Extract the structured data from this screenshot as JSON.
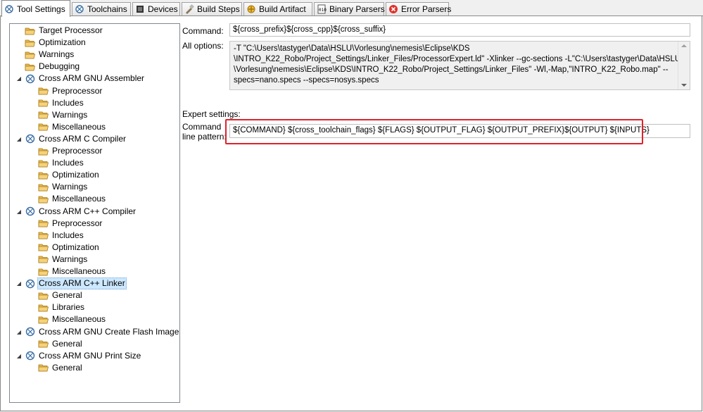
{
  "tabs": [
    {
      "label": "Tool Settings",
      "icon": "tool-settings-icon"
    },
    {
      "label": "Toolchains",
      "icon": "toolchains-icon"
    },
    {
      "label": "Devices",
      "icon": "devices-icon"
    },
    {
      "label": "Build Steps",
      "icon": "build-steps-icon"
    },
    {
      "label": "Build Artifact",
      "icon": "build-artifact-icon"
    },
    {
      "label": "Binary Parsers",
      "icon": "binary-parsers-icon"
    },
    {
      "label": "Error Parsers",
      "icon": "error-parsers-icon"
    }
  ],
  "tree": {
    "items": [
      {
        "label": "Target Processor",
        "level": 1,
        "type": "folder"
      },
      {
        "label": "Optimization",
        "level": 1,
        "type": "folder"
      },
      {
        "label": "Warnings",
        "level": 1,
        "type": "folder"
      },
      {
        "label": "Debugging",
        "level": 1,
        "type": "folder"
      },
      {
        "label": "Cross ARM GNU Assembler",
        "level": 1,
        "type": "tool",
        "expanded": true
      },
      {
        "label": "Preprocessor",
        "level": 2,
        "type": "folder"
      },
      {
        "label": "Includes",
        "level": 2,
        "type": "folder"
      },
      {
        "label": "Warnings",
        "level": 2,
        "type": "folder"
      },
      {
        "label": "Miscellaneous",
        "level": 2,
        "type": "folder"
      },
      {
        "label": "Cross ARM C Compiler",
        "level": 1,
        "type": "tool",
        "expanded": true
      },
      {
        "label": "Preprocessor",
        "level": 2,
        "type": "folder"
      },
      {
        "label": "Includes",
        "level": 2,
        "type": "folder"
      },
      {
        "label": "Optimization",
        "level": 2,
        "type": "folder"
      },
      {
        "label": "Warnings",
        "level": 2,
        "type": "folder"
      },
      {
        "label": "Miscellaneous",
        "level": 2,
        "type": "folder"
      },
      {
        "label": "Cross ARM C++ Compiler",
        "level": 1,
        "type": "tool",
        "expanded": true
      },
      {
        "label": "Preprocessor",
        "level": 2,
        "type": "folder"
      },
      {
        "label": "Includes",
        "level": 2,
        "type": "folder"
      },
      {
        "label": "Optimization",
        "level": 2,
        "type": "folder"
      },
      {
        "label": "Warnings",
        "level": 2,
        "type": "folder"
      },
      {
        "label": "Miscellaneous",
        "level": 2,
        "type": "folder"
      },
      {
        "label": "Cross ARM C++ Linker",
        "level": 1,
        "type": "tool",
        "expanded": true,
        "selected": true
      },
      {
        "label": "General",
        "level": 2,
        "type": "folder"
      },
      {
        "label": "Libraries",
        "level": 2,
        "type": "folder"
      },
      {
        "label": "Miscellaneous",
        "level": 2,
        "type": "folder"
      },
      {
        "label": "Cross ARM GNU Create Flash Image",
        "level": 1,
        "type": "tool",
        "expanded": true
      },
      {
        "label": "General",
        "level": 2,
        "type": "folder"
      },
      {
        "label": "Cross ARM GNU Print Size",
        "level": 1,
        "type": "tool",
        "expanded": true
      },
      {
        "label": "General",
        "level": 2,
        "type": "folder"
      }
    ]
  },
  "settings": {
    "command_label": "Command:",
    "command_value": "${cross_prefix}${cross_cpp}${cross_suffix}",
    "all_options_label": "All options:",
    "all_options_lines": [
      "-T \"C:\\Users\\tastyger\\Data\\HSLU\\Vorlesung\\nemesis\\Eclipse\\KDS",
      "\\INTRO_K22_Robo/Project_Settings/Linker_Files/ProcessorExpert.ld\" -Xlinker --gc-sections -L\"C:\\Users\\tastyger\\Data\\HSLU",
      "\\Vorlesung\\nemesis\\Eclipse\\KDS\\INTRO_K22_Robo/Project_Settings/Linker_Files\" -Wl,-Map,\"INTRO_K22_Robo.map\" --",
      "specs=nano.specs --specs=nosys.specs"
    ],
    "expert_label": "Expert settings:",
    "pattern_label_1": "Command",
    "pattern_label_2": "line pattern:",
    "pattern_value": "${COMMAND} ${cross_toolchain_flags} ${FLAGS} ${OUTPUT_FLAG} ${OUTPUT_PREFIX}${OUTPUT} ${INPUTS}"
  },
  "colors": {
    "selection": "#cce8ff",
    "highlight_box": "#e0222b",
    "folder": "#e8b94a"
  }
}
